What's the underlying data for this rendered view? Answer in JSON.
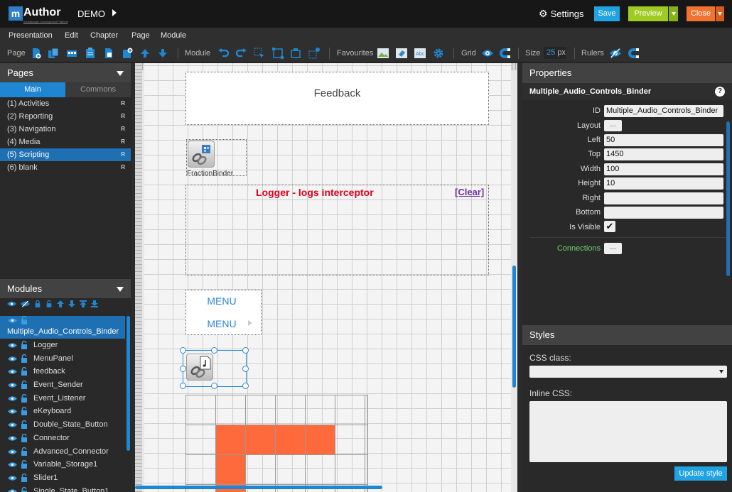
{
  "app": {
    "logo_letter": "m",
    "logo_text": "Author",
    "logo_sub": "eduManager Development Platform",
    "project": "DEMO"
  },
  "topbar": {
    "settings": "Settings",
    "save": "Save",
    "preview": "Preview",
    "close": "Close"
  },
  "colors": {
    "accent": "#1f86d1",
    "save": "#1fa3e2",
    "preview": "#9fcc23",
    "close": "#f27230",
    "logger_title": "#e2001a",
    "menu_text": "#2d87d8",
    "table_fill": "#ff6a3d"
  },
  "menu": [
    "Presentation",
    "Edit",
    "Chapter",
    "Page",
    "Module"
  ],
  "toolbar": {
    "page_label": "Page",
    "page_icons": [
      "add-page-icon",
      "duplicate-page-icon",
      "import-page-icon",
      "paste-page-icon",
      "page-settings-icon",
      "add-chapter-icon",
      "move-up-icon",
      "move-down-icon"
    ],
    "module_label": "Module",
    "module_icons": [
      "undo-icon",
      "redo-icon",
      "select-icon",
      "group-icon",
      "align-icon",
      "distribute-icon"
    ],
    "favourites_label": "Favourites",
    "favourites_icons": [
      "image-icon",
      "eraser-icon",
      "text-icon",
      "gear-icon"
    ],
    "grid_label": "Grid",
    "grid_icons": [
      "eye-icon",
      "magnet-icon"
    ],
    "size_label": "Size",
    "size_value": "25",
    "size_unit": "px",
    "rulers_label": "Rulers",
    "rulers_icons": [
      "eye-slash-icon",
      "magnet-icon"
    ]
  },
  "pages": {
    "title": "Pages",
    "tabs": [
      "Main",
      "Commons"
    ],
    "items": [
      {
        "label": "(1) Activities",
        "badge": "R"
      },
      {
        "label": "(2) Reporting",
        "badge": "R"
      },
      {
        "label": "(3) Navigation",
        "badge": "R"
      },
      {
        "label": "(4) Media",
        "badge": "R"
      },
      {
        "label": "(5) Scripting",
        "badge": "R",
        "selected": true
      },
      {
        "label": "(6) blank",
        "badge": "R"
      }
    ]
  },
  "modules": {
    "title": "Modules",
    "tool_icons": [
      "show-all-icon",
      "hide-all-icon",
      "lock-all-icon",
      "unlock-all-icon",
      "move-up-icon",
      "move-down-icon",
      "move-top-icon",
      "move-bottom-icon"
    ],
    "items": [
      {
        "label": "Multiple_Audio_Controls_Binder",
        "selected": true
      },
      {
        "label": "Logger"
      },
      {
        "label": "MenuPanel"
      },
      {
        "label": "feedback"
      },
      {
        "label": "Event_Sender"
      },
      {
        "label": "Event_Listener"
      },
      {
        "label": "eKeyboard"
      },
      {
        "label": "Double_State_Button"
      },
      {
        "label": "Connector"
      },
      {
        "label": "Advanced_Connector"
      },
      {
        "label": "Variable_Storage1"
      },
      {
        "label": "Slider1"
      },
      {
        "label": "Single_State_Button1"
      }
    ]
  },
  "canvas": {
    "feedback_text": "Feedback",
    "fraction_label": "FractionBinder",
    "logger_title": "Logger - logs interceptor",
    "logger_clear": "[Clear]",
    "menu_items": [
      "MENU",
      "MENU"
    ]
  },
  "properties": {
    "title": "Properties",
    "module_name": "Multiple_Audio_Controls_Binder",
    "help": "?",
    "id_label": "ID",
    "id_value": "Multiple_Audio_Controls_Binder",
    "layout_label": "Layout",
    "layout_btn": "...",
    "left_label": "Left",
    "left_value": "50",
    "top_label": "Top",
    "top_value": "1450",
    "width_label": "Width",
    "width_value": "100",
    "height_label": "Height",
    "height_value": "10",
    "right_label": "Right",
    "right_value": "",
    "bottom_label": "Bottom",
    "bottom_value": "",
    "visible_label": "Is Visible",
    "visible_checked": true,
    "connections_label": "Connections",
    "connections_btn": "..."
  },
  "styles": {
    "title": "Styles",
    "css_class_label": "CSS class:",
    "css_class_value": "",
    "inline_css_label": "Inline CSS:",
    "inline_css_value": "",
    "update_btn": "Update style"
  }
}
